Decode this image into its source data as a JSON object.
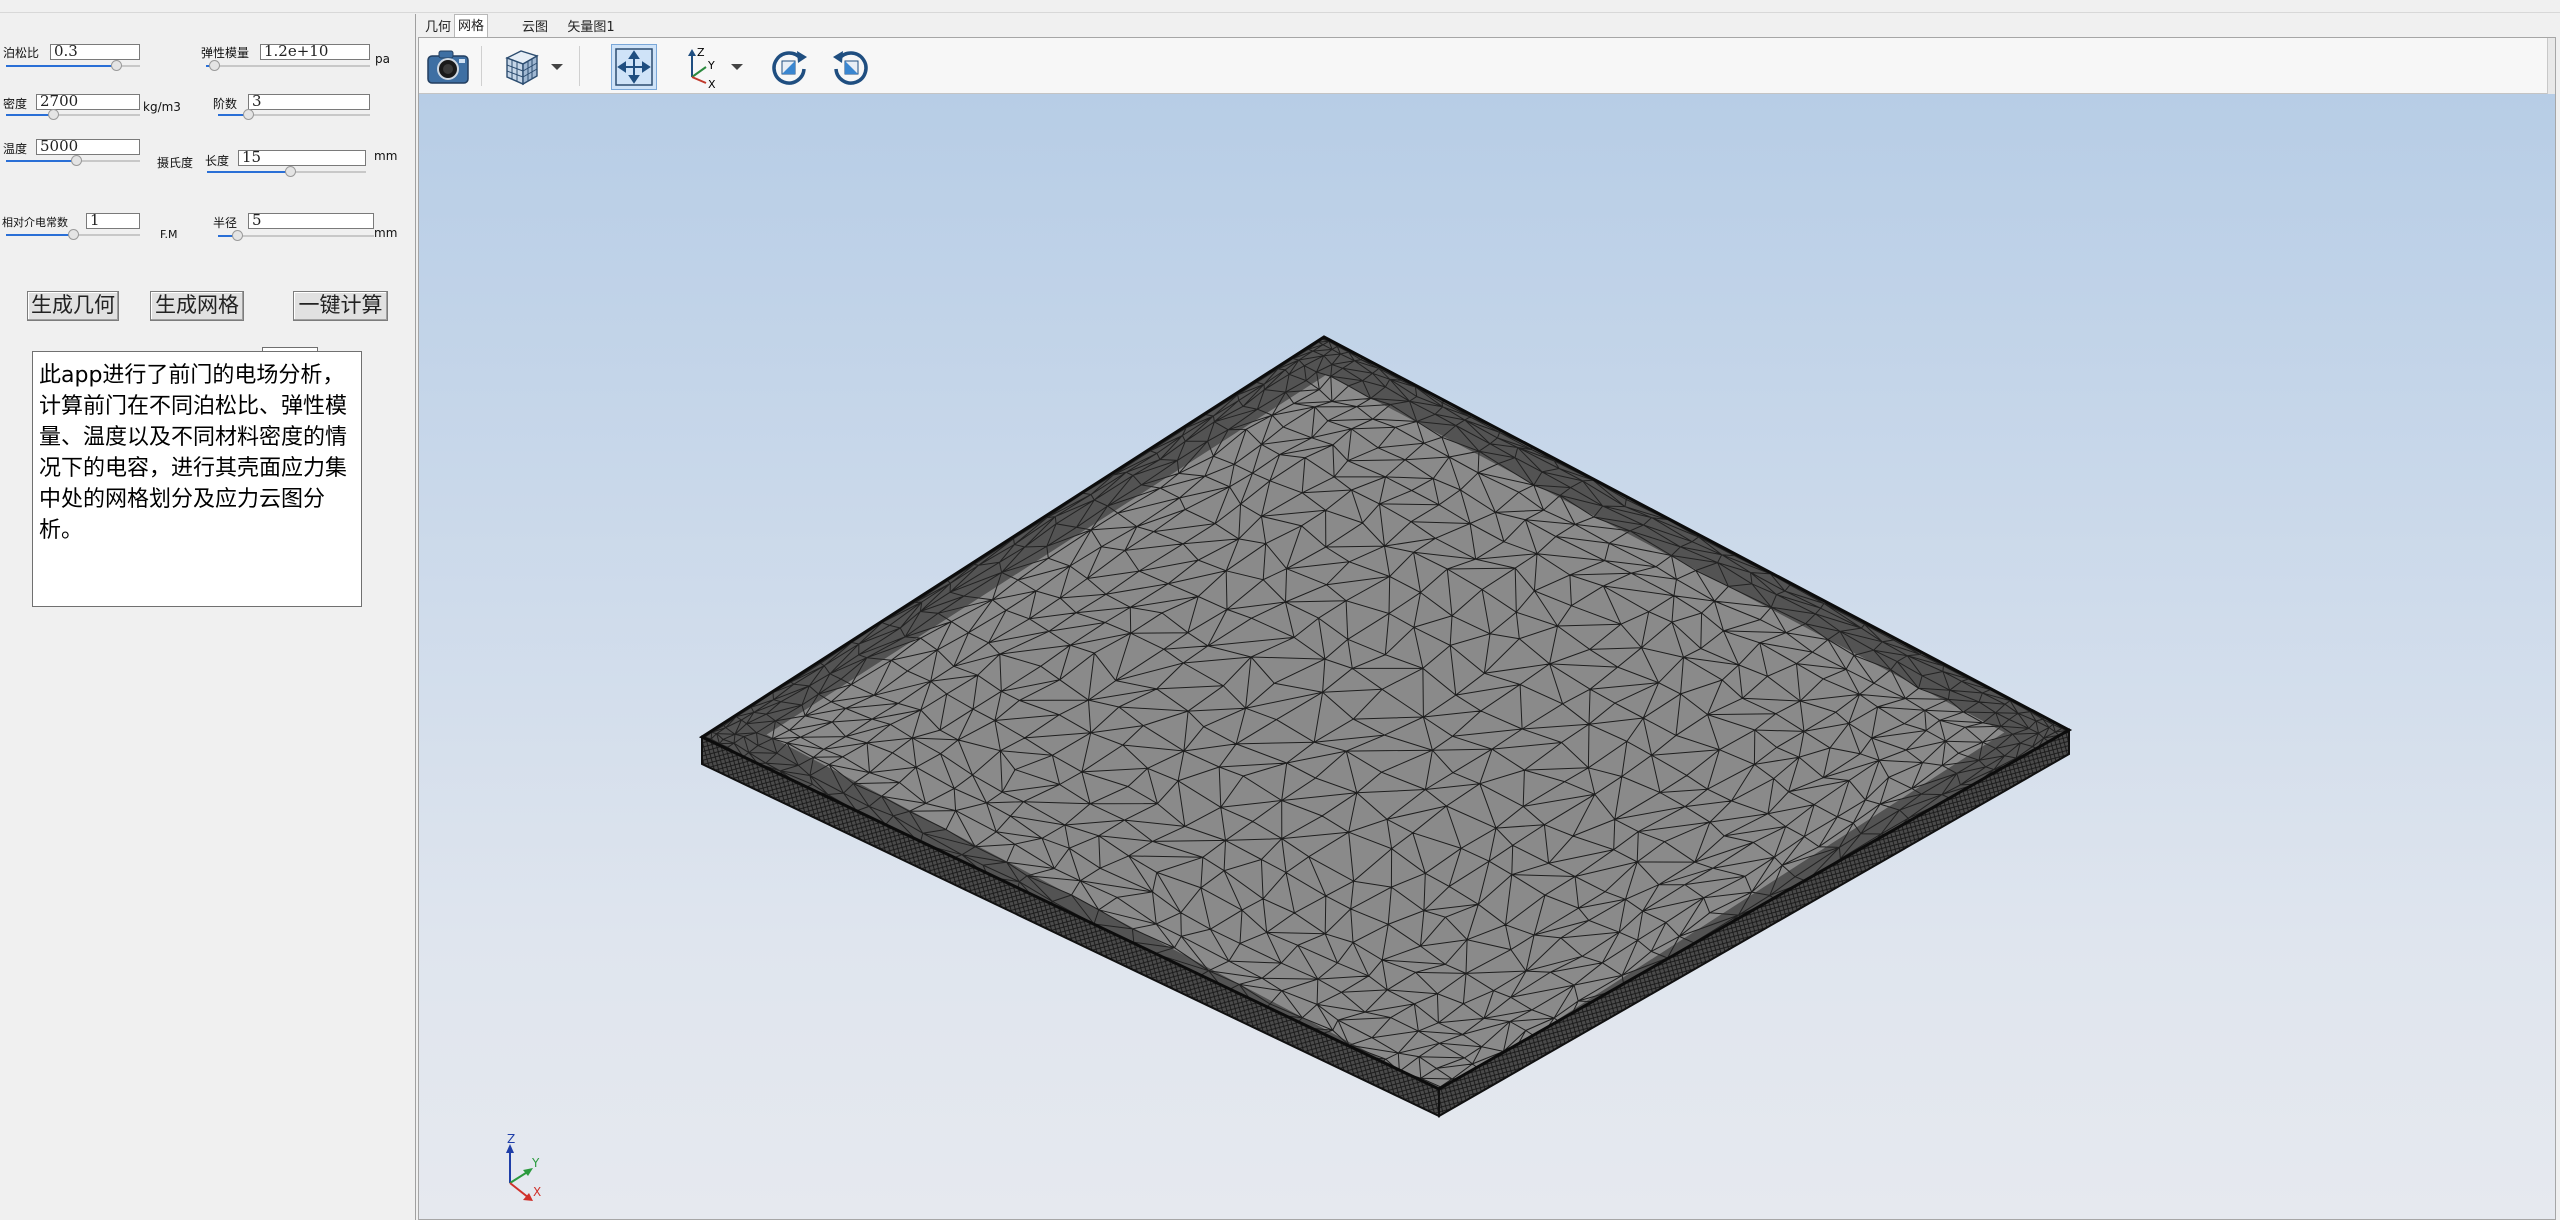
{
  "params": {
    "poisson": {
      "label": "泊松比",
      "value": "0.3",
      "slider": 0.82
    },
    "modulus": {
      "label": "弹性模量",
      "value": "1.2e+10",
      "unit": "pa",
      "slider": 0.05
    },
    "density": {
      "label": "密度",
      "value": "2700",
      "unit": "kg/m3",
      "slider": 0.35
    },
    "order": {
      "label": "阶数",
      "value": "3",
      "slider": 0.2
    },
    "temperature": {
      "label": "温度",
      "value": "5000",
      "unit": "摄氏度",
      "slider": 0.52
    },
    "length": {
      "label": "长度",
      "value": "15",
      "unit": "mm",
      "slider": 0.52
    },
    "permittivity": {
      "label": "相对介电常数",
      "value": "1",
      "unit": "F.M",
      "slider": 0.5
    },
    "radius": {
      "label": "半径",
      "value": "5",
      "unit": "mm",
      "slider": 0.12
    }
  },
  "buttons": {
    "geometry": "生成几何",
    "mesh": "生成网格",
    "compute": "一键计算"
  },
  "description": "此app进行了前门的电场分析，计算前门在不同泊松比、弹性模量、温度以及不同材料密度的情况下的电容，进行其壳面应力集中处的网格划分及应力云图分析。",
  "tabs": [
    "几何",
    "网格",
    "云图",
    "矢量图1"
  ],
  "active_tab": "网格",
  "toolbar": {
    "icons": [
      "camera-icon",
      "view-cube-icon",
      "dropdown-arrow-icon",
      "fit-view-icon",
      "axis-triad-icon",
      "dropdown-arrow-icon",
      "rotate-cw-icon",
      "rotate-ccw-icon"
    ]
  },
  "axes": {
    "x": "X",
    "y": "Y",
    "z": "Z"
  },
  "colors": {
    "slider_fill": "#2a6fd6",
    "mesh_face": "#8a8a8a",
    "mesh_line": "#1e1e1e"
  }
}
